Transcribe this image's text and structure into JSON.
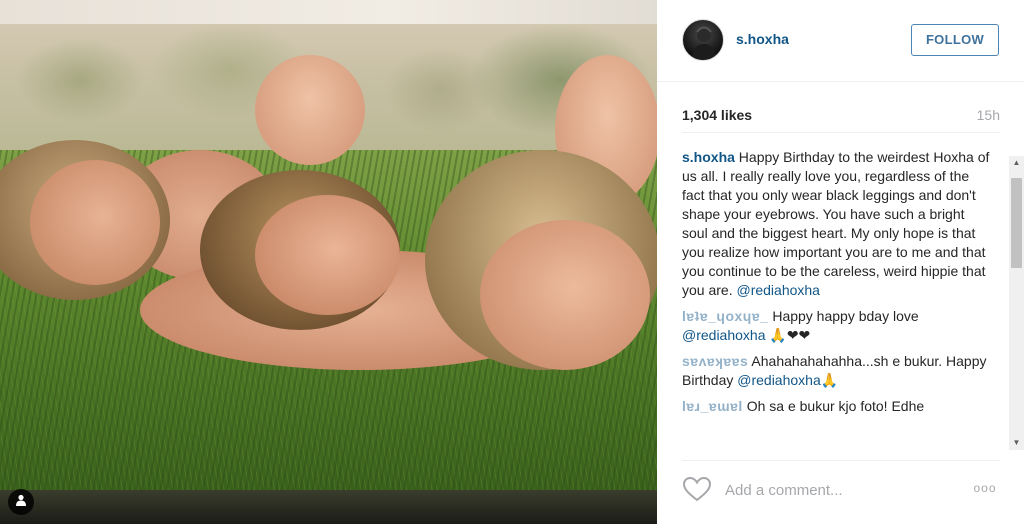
{
  "post": {
    "username": "s.hoxha",
    "follow_label": "FOLLOW",
    "likes": "1,304 likes",
    "time": "15h"
  },
  "comments": [
    {
      "user": "s.hoxha",
      "text": "Happy Birthday to the weirdest Hoxha of us all. I really really love you, regardless of the fact that you only wear black leggings and don't shape your eyebrows. You have such a bright soul and the biggest heart. My only hope is that you realize how important you are to me and that you continue to be the careless, weird hippie that you are.",
      "mention": "@rediahoxha"
    },
    {
      "user": "lɐʇɐ_ɥoxɥɐ_",
      "text": "Happy happy bday love",
      "mention": "@rediahoxha",
      "suffix": "🙏❤❤"
    },
    {
      "user": "sɐʌɐʞɐɐs",
      "text": "Ahahahahahahha...sh e bukur. Happy Birthday",
      "mention": "@rediahoxha",
      "suffix": "🙏"
    },
    {
      "user": "lɐɹ_ɐɯɐl",
      "text": "Oh sa e bukur kjo foto! Edhe"
    }
  ],
  "footer": {
    "comment_placeholder": "Add a comment...",
    "more_label": "ooo"
  },
  "icons": {
    "heart": "heart-outline-icon",
    "user_tag": "user-tag-icon",
    "more": "more-options-icon"
  },
  "colors": {
    "link": "#125688",
    "follow_border": "#4c84b4",
    "muted": "#a5a7aa"
  }
}
